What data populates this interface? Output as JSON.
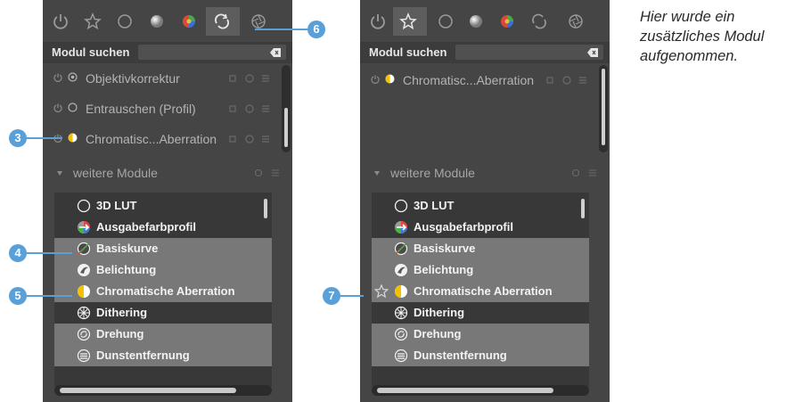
{
  "colors": {
    "panel": "#454545",
    "list_dark": "#383838",
    "list_light": "#787878",
    "callout": "#5aa0d8"
  },
  "panels": [
    {
      "tabs": [
        {
          "icon": "power-icon"
        },
        {
          "icon": "star-icon"
        },
        {
          "icon": "circle-icon"
        },
        {
          "icon": "sphere-icon"
        },
        {
          "icon": "color-icon"
        },
        {
          "icon": "rotate-icon",
          "active": true
        },
        {
          "icon": "aperture-icon"
        }
      ],
      "search": {
        "label": "Modul suchen",
        "value": ""
      },
      "active_modules": [
        {
          "name": "Objektivkorrektur",
          "icon": "lens-icon"
        },
        {
          "name": "Entrauschen (Profil)",
          "icon": "circle-icon"
        },
        {
          "name": "Chromatisc...Aberration",
          "icon": "chroma-icon"
        }
      ],
      "section": "weitere Module",
      "list": [
        {
          "label": "3D LUT",
          "icon": "circle-icon",
          "shade": "dark"
        },
        {
          "label": "Ausgabefarbprofil",
          "icon": "color-profile-icon",
          "shade": "dark"
        },
        {
          "label": "Basiskurve",
          "icon": "curve-icon",
          "shade": "light"
        },
        {
          "label": "Belichtung",
          "icon": "exposure-icon",
          "shade": "light"
        },
        {
          "label": "Chromatische Aberration",
          "icon": "chroma-icon",
          "shade": "light"
        },
        {
          "label": "Dithering",
          "icon": "dither-icon",
          "shade": "dark"
        },
        {
          "label": "Drehung",
          "icon": "rotation-icon",
          "shade": "light"
        },
        {
          "label": "Dunstentfernung",
          "icon": "haze-icon",
          "shade": "light"
        }
      ]
    },
    {
      "tabs": [
        {
          "icon": "power-icon"
        },
        {
          "icon": "star-icon",
          "active": true
        },
        {
          "icon": "circle-icon"
        },
        {
          "icon": "sphere-icon"
        },
        {
          "icon": "color-icon"
        },
        {
          "icon": "rotate-icon"
        },
        {
          "icon": "aperture-icon"
        }
      ],
      "search": {
        "label": "Modul suchen",
        "value": ""
      },
      "active_modules": [
        {
          "name": "Chromatisc...Aberration",
          "icon": "chroma-icon"
        }
      ],
      "section": "weitere Module",
      "list": [
        {
          "label": "3D LUT",
          "icon": "circle-icon",
          "shade": "dark"
        },
        {
          "label": "Ausgabefarbprofil",
          "icon": "color-profile-icon",
          "shade": "dark"
        },
        {
          "label": "Basiskurve",
          "icon": "curve-icon",
          "shade": "light"
        },
        {
          "label": "Belichtung",
          "icon": "exposure-icon",
          "shade": "light"
        },
        {
          "label": "Chromatische Aberration",
          "icon": "chroma-icon",
          "shade": "light",
          "favorite": true
        },
        {
          "label": "Dithering",
          "icon": "dither-icon",
          "shade": "dark"
        },
        {
          "label": "Drehung",
          "icon": "rotation-icon",
          "shade": "light"
        },
        {
          "label": "Dunstentfernung",
          "icon": "haze-icon",
          "shade": "light"
        }
      ]
    }
  ],
  "callouts": [
    "3",
    "4",
    "5",
    "6",
    "7"
  ],
  "caption": [
    "Hier wurde ein",
    "zusätzliches Modul",
    "aufgenommen."
  ]
}
